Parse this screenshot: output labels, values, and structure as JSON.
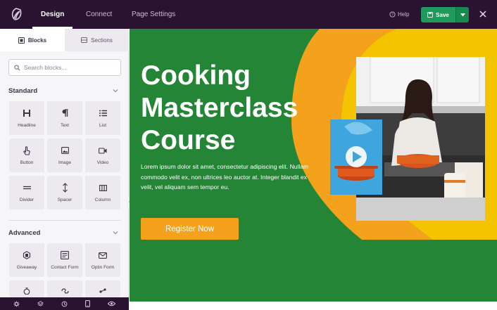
{
  "topbar": {
    "tabs": [
      "Design",
      "Connect",
      "Page Settings"
    ],
    "help_label": "Help",
    "save_label": "Save"
  },
  "sidebar": {
    "tabs": {
      "blocks": "Blocks",
      "sections": "Sections"
    },
    "search_placeholder": "Search blocks...",
    "standard": {
      "title": "Standard",
      "blocks": [
        "Headline",
        "Text",
        "List",
        "Button",
        "Image",
        "Video",
        "Divider",
        "Spacer",
        "Column"
      ]
    },
    "advanced": {
      "title": "Advanced",
      "blocks": [
        "Giveaway",
        "Contact Form",
        "Optin Form"
      ]
    }
  },
  "hero": {
    "title": "Cooking Masterclass Course",
    "body": "Lorem ipsum dolor sit amet, consectetur adipiscing elit. Nullam commodo velit ex, non ultrices leo auctor at. Integer blandit ex velit, vel aliquam sem tempor eu.",
    "button_label": "Register Now"
  },
  "colors": {
    "topbar": "#2a1330",
    "canvas_green": "#258536",
    "accent_orange": "#f4a21c",
    "accent_yellow": "#f5c400",
    "save_green": "#1f9a5b"
  }
}
